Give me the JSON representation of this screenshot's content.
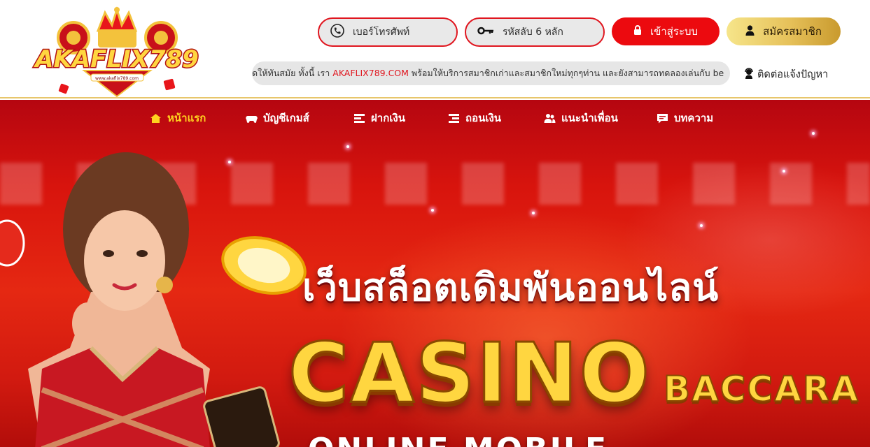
{
  "header": {
    "logo_text": "AKAFLIX789",
    "logo_subtext": "www.akaflix789.com",
    "phone": {
      "placeholder": "เบอร์โทรศัพท์"
    },
    "password": {
      "placeholder": "รหัสลับ 6 หลัก"
    },
    "login_label": "เข้าสู่ระบบ",
    "register_label": "สมัครสมาชิก",
    "marquee": {
      "before": "ดให้ทันสมัย ทั้งนี้ เรา ",
      "site": "AKAFLIX789.COM",
      "after": " พร้อมให้บริการสมาชิกเก่าและสมาชิกใหม่ทุกๆท่าน และยังสามารถทดลองเล่นกับ be"
    },
    "support_label": "ติดต่อแจ้งปัญหา"
  },
  "nav": {
    "items": [
      {
        "label": "หน้าแรก",
        "icon": "home-icon"
      },
      {
        "label": "บัญชีเกมส์",
        "icon": "gamepad-icon"
      },
      {
        "label": "ฝากเงิน",
        "icon": "deposit-icon"
      },
      {
        "label": "ถอนเงิน",
        "icon": "withdraw-icon"
      },
      {
        "label": "แนะนำเพื่อน",
        "icon": "users-icon"
      },
      {
        "label": "บทความ",
        "icon": "comment-icon"
      }
    ]
  },
  "hero": {
    "title": "เว็บสล็อตเดิมพันออนไลน์",
    "casino": "CASINO",
    "baccarat": "BACCARA",
    "subline": "ONLINE MOBILE"
  },
  "colors": {
    "accent_red": "#ec0a0f",
    "gold": "#e6c15a",
    "nav_active": "#ffd21f"
  }
}
